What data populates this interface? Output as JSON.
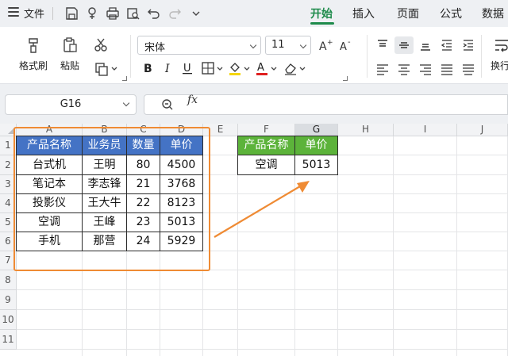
{
  "topbar": {
    "file_label": "文件",
    "tabs": [
      "开始",
      "插入",
      "页面",
      "公式",
      "数据"
    ],
    "active_tab": "开始",
    "accent": "#1e8b4b"
  },
  "ribbon": {
    "format_painter": "格式刷",
    "paste": "粘贴",
    "font_name": "宋体",
    "font_size": "11",
    "wrap_partial": "换行"
  },
  "formula_bar": {
    "name_box": "G16",
    "fx": "fx",
    "formula": ""
  },
  "sheet": {
    "columns": [
      "A",
      "B",
      "C",
      "D",
      "E",
      "F",
      "G",
      "H",
      "I",
      "J"
    ],
    "selected_column": "G",
    "rows": [
      "1",
      "2",
      "3",
      "4",
      "5",
      "6",
      "7",
      "8",
      "9",
      "10",
      "11"
    ],
    "table_header": [
      "产品名称",
      "业务员",
      "数量",
      "单价"
    ],
    "table_rows": [
      [
        "台式机",
        "王明",
        "80",
        "4500"
      ],
      [
        "笔记本",
        "李志锋",
        "21",
        "3768"
      ],
      [
        "投影仪",
        "王大牛",
        "22",
        "8123"
      ],
      [
        "空调",
        "王峰",
        "23",
        "5013"
      ],
      [
        "手机",
        "那营",
        "24",
        "5929"
      ]
    ],
    "lookup_header": [
      "产品名称",
      "单价"
    ],
    "lookup_row": [
      "空调",
      "5013"
    ],
    "colors": {
      "header_blue": "#4473c5",
      "header_green": "#5cb33a",
      "highlight_orange": "#ef8b34"
    }
  }
}
